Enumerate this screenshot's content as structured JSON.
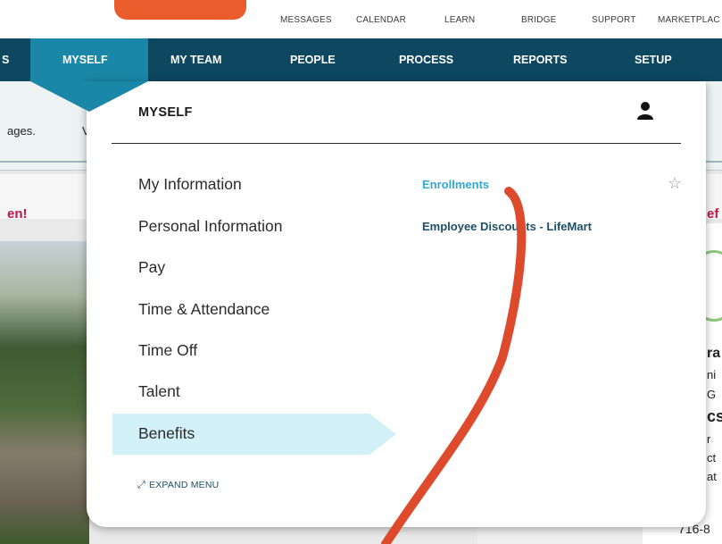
{
  "utility_nav": {
    "items": [
      "MESSAGES",
      "CALENDAR",
      "LEARN",
      "BRIDGE",
      "SUPPORT",
      "MARKETPLAC"
    ]
  },
  "main_nav": {
    "partial_left": "S",
    "items": [
      "MYSELF",
      "MY TEAM",
      "PEOPLE",
      "PROCESS",
      "REPORTS",
      "SETUP"
    ],
    "active": "MYSELF"
  },
  "background": {
    "text_left_1": "ages.",
    "text_left_2": "V",
    "banner_left": "en!",
    "banner_right": "ef",
    "right_lines": [
      "ra",
      "ni",
      "G",
      "cs",
      "r",
      "ct",
      "at",
      "716-8"
    ]
  },
  "menu": {
    "title": "MYSELF",
    "items": [
      "My Information",
      "Personal Information",
      "Pay",
      "Time & Attendance",
      "Time Off",
      "Talent",
      "Benefits"
    ],
    "selected": "Benefits",
    "expand_label": "EXPAND MENU",
    "sub_links": [
      "Enrollments",
      "Employee Discounts - LifeMart"
    ]
  },
  "colors": {
    "nav_bg": "#0e4760",
    "nav_active": "#1b87a8",
    "selected_bg": "#d2f0f8",
    "accent_orange": "#ea5c2b",
    "annotation_red": "#dd4a2c"
  }
}
